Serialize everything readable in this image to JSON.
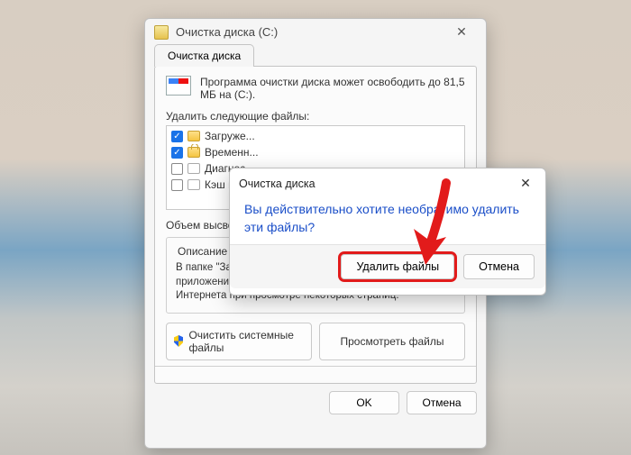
{
  "parent": {
    "title": "Очистка диска  (C:)",
    "tab": "Очистка диска",
    "info": "Программа очистки диска может освободить до 81,5 МБ на  (C:).",
    "files_label": "Удалить следующие файлы:",
    "files": [
      {
        "checked": true,
        "icon": "fld",
        "name": "Загруже..."
      },
      {
        "checked": true,
        "icon": "lock",
        "name": "Временн..."
      },
      {
        "checked": false,
        "icon": "file",
        "name": "Диагнос..."
      },
      {
        "checked": false,
        "icon": "file",
        "name": "Кэш пос..."
      }
    ],
    "freed_label": "Объем высвобож...",
    "fieldset_legend": "Описание",
    "description": "В папке \"Загр...\nсохраняются элементы ActiveX и приложения Java, автоматически загружаемые из Интернета при просмотре некоторых страниц.",
    "btn_clean_sys": "Очистить системные файлы",
    "btn_view": "Просмотреть файлы",
    "ok": "OK",
    "cancel": "Отмена"
  },
  "dialog": {
    "title": "Очистка диска",
    "message": "Вы действительно хотите необратимо удалить эти файлы?",
    "confirm": "Удалить файлы",
    "cancel": "Отмена"
  }
}
